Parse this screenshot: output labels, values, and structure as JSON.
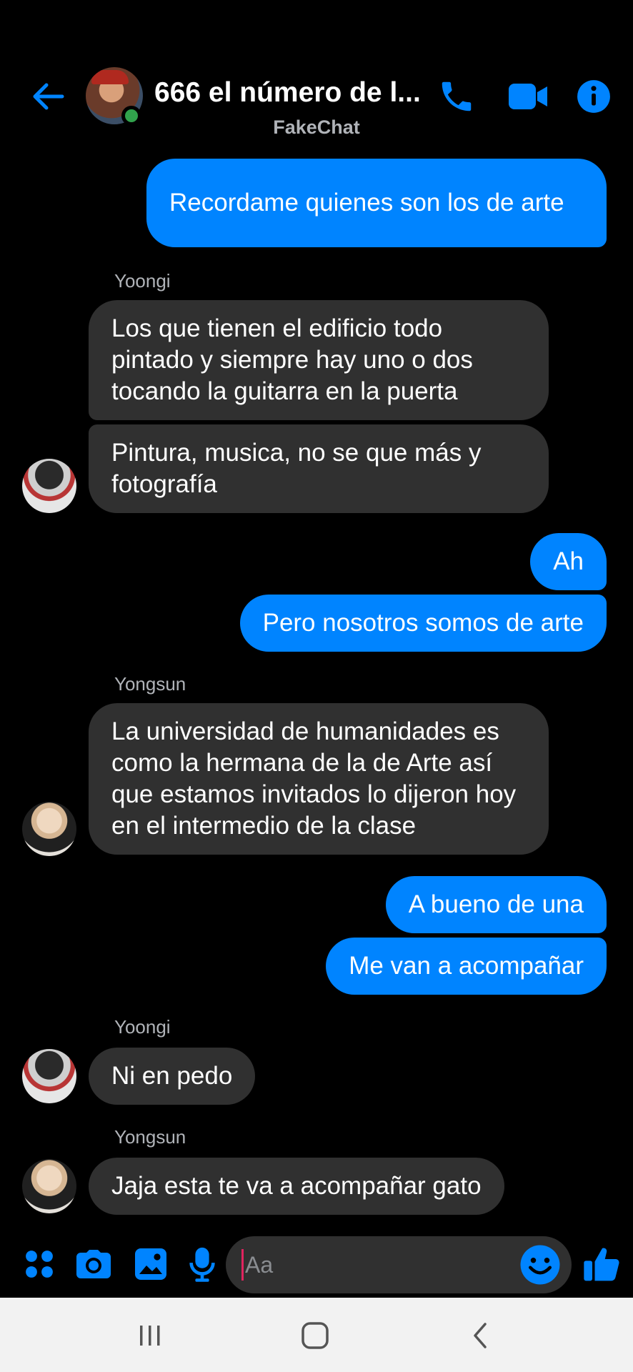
{
  "header": {
    "title": "666 el número de l...",
    "subtitle": "FakeChat"
  },
  "messages": {
    "m1": "Recordame quienes son los de arte",
    "s1": "Yoongi",
    "m2": "Los que tienen el edificio todo pintado y siempre hay uno o dos tocando la guitarra en la puerta",
    "m3": "Pintura, musica, no se que más y fotografía",
    "m4": "Ah",
    "m5": "Pero nosotros somos de arte",
    "s2": "Yongsun",
    "m6": "La universidad de humanidades es como la hermana de la de Arte así que estamos invitados lo dijeron hoy en el intermedio de la clase",
    "m7": "A bueno de una",
    "m8": "Me van a acompañar",
    "s3": "Yoongi",
    "m9": "Ni en pedo",
    "s4": "Yongsun",
    "m10": "Jaja esta te va a acompañar gato"
  },
  "composer": {
    "placeholder": "Aa"
  },
  "colors": {
    "accent": "#0084ff",
    "incoming_bubble": "#303030",
    "online": "#31a24c"
  },
  "icons": [
    "back-arrow-icon",
    "phone-icon",
    "video-camera-icon",
    "info-icon",
    "apps-icon",
    "camera-icon",
    "gallery-icon",
    "microphone-icon",
    "emoji-icon",
    "thumbs-up-icon",
    "recent-apps-icon",
    "home-icon",
    "back-nav-icon"
  ]
}
